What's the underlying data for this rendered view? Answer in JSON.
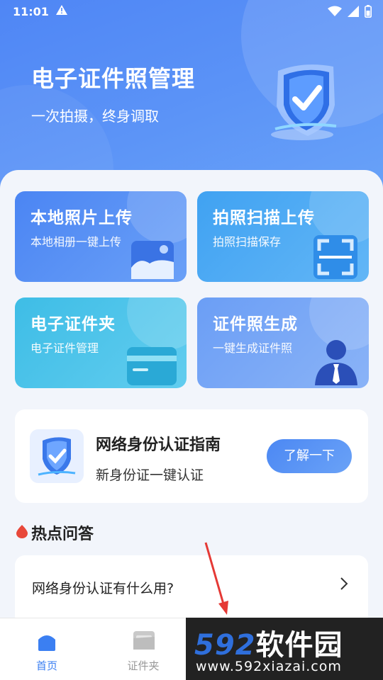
{
  "status_bar": {
    "time": "11:01",
    "warn_icon": "warning-icon",
    "wifi_icon": "wifi-icon",
    "signal_icon": "signal-icon",
    "battery_icon": "battery-icon"
  },
  "hero": {
    "title": "电子证件照管理",
    "subtitle": "一次拍摄，终身调取",
    "illustration": "shield-check-icon"
  },
  "cards": [
    {
      "title": "本地照片上传",
      "subtitle": "本地相册一键上传",
      "icon": "image-icon"
    },
    {
      "title": "拍照扫描上传",
      "subtitle": "拍照扫描保存",
      "icon": "scan-icon"
    },
    {
      "title": "电子证件夹",
      "subtitle": "电子证件管理",
      "icon": "card-icon"
    },
    {
      "title": "证件照生成",
      "subtitle": "一键生成证件照",
      "icon": "person-icon"
    }
  ],
  "guide": {
    "title": "网络身份认证指南",
    "subtitle": "新身份证一键认证",
    "button": "了解一下",
    "icon": "shield-check-icon"
  },
  "hot": {
    "title": "热点问答",
    "icon": "fire-drop-icon"
  },
  "faq": [
    {
      "question": "网络身份认证有什么用?"
    }
  ],
  "tabbar": {
    "items": [
      {
        "label": "首页",
        "icon": "home-icon",
        "active": true
      },
      {
        "label": "证件夹",
        "icon": "folder-icon",
        "active": false
      }
    ]
  },
  "watermark": {
    "logo_num": "592",
    "logo_text": "软件园",
    "url": "www.592xiazai.com"
  },
  "colors": {
    "primary": "#4c88f3",
    "active_tab": "#3b7ff2",
    "inactive_tab": "#999999"
  }
}
